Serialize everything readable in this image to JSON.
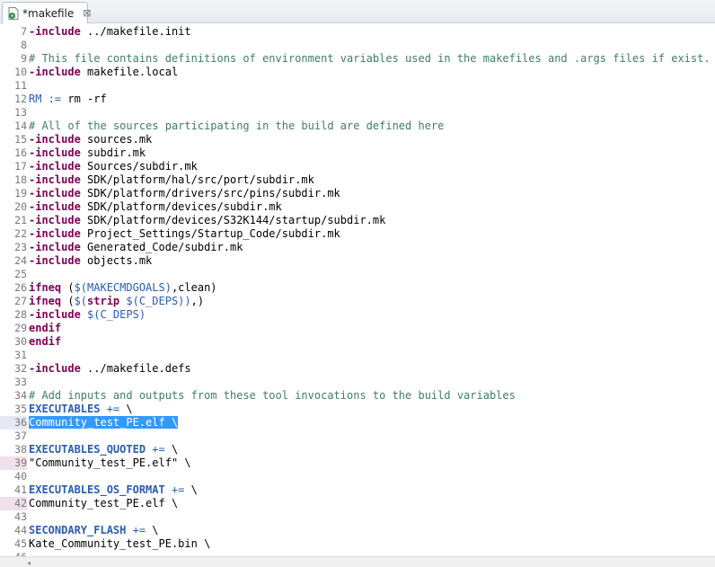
{
  "tab": {
    "title": "*makefile",
    "close_glyph": "⊠"
  },
  "lines": [
    {
      "n": "7",
      "parts": [
        {
          "c": "kw",
          "t": "-include"
        },
        {
          "c": "txt",
          "t": " ../makefile.init"
        }
      ]
    },
    {
      "n": "8",
      "parts": []
    },
    {
      "n": "9",
      "parts": [
        {
          "c": "cmt",
          "t": "# This file contains definitions of environment variables used in the makefiles and .args files if exist."
        }
      ]
    },
    {
      "n": "10",
      "parts": [
        {
          "c": "kw",
          "t": "-include"
        },
        {
          "c": "txt",
          "t": " makefile.local"
        }
      ]
    },
    {
      "n": "11",
      "parts": []
    },
    {
      "n": "12",
      "parts": [
        {
          "c": "var",
          "t": "RM"
        },
        {
          "c": "op",
          "t": " :="
        },
        {
          "c": "txt",
          "t": " rm -rf"
        }
      ]
    },
    {
      "n": "13",
      "parts": []
    },
    {
      "n": "14",
      "parts": [
        {
          "c": "cmt",
          "t": "# All of the sources participating in the build are defined here"
        }
      ]
    },
    {
      "n": "15",
      "parts": [
        {
          "c": "kw",
          "t": "-include"
        },
        {
          "c": "txt",
          "t": " sources.mk"
        }
      ]
    },
    {
      "n": "16",
      "parts": [
        {
          "c": "kw",
          "t": "-include"
        },
        {
          "c": "txt",
          "t": " subdir.mk"
        }
      ]
    },
    {
      "n": "17",
      "parts": [
        {
          "c": "kw",
          "t": "-include"
        },
        {
          "c": "txt",
          "t": " Sources/subdir.mk"
        }
      ]
    },
    {
      "n": "18",
      "parts": [
        {
          "c": "kw",
          "t": "-include"
        },
        {
          "c": "txt",
          "t": " SDK/platform/hal/src/port/subdir.mk"
        }
      ]
    },
    {
      "n": "19",
      "parts": [
        {
          "c": "kw",
          "t": "-include"
        },
        {
          "c": "txt",
          "t": " SDK/platform/drivers/src/pins/subdir.mk"
        }
      ]
    },
    {
      "n": "20",
      "parts": [
        {
          "c": "kw",
          "t": "-include"
        },
        {
          "c": "txt",
          "t": " SDK/platform/devices/subdir.mk"
        }
      ]
    },
    {
      "n": "21",
      "parts": [
        {
          "c": "kw",
          "t": "-include"
        },
        {
          "c": "txt",
          "t": " SDK/platform/devices/S32K144/startup/subdir.mk"
        }
      ]
    },
    {
      "n": "22",
      "parts": [
        {
          "c": "kw",
          "t": "-include"
        },
        {
          "c": "txt",
          "t": " Project_Settings/Startup_Code/subdir.mk"
        }
      ]
    },
    {
      "n": "23",
      "parts": [
        {
          "c": "kw",
          "t": "-include"
        },
        {
          "c": "txt",
          "t": " Generated_Code/subdir.mk"
        }
      ]
    },
    {
      "n": "24",
      "parts": [
        {
          "c": "kw",
          "t": "-include"
        },
        {
          "c": "txt",
          "t": " objects.mk"
        }
      ]
    },
    {
      "n": "25",
      "parts": []
    },
    {
      "n": "26",
      "parts": [
        {
          "c": "kw",
          "t": "ifneq"
        },
        {
          "c": "txt",
          "t": " ("
        },
        {
          "c": "var",
          "t": "$(MAKECMDGOALS)"
        },
        {
          "c": "txt",
          "t": ",clean)"
        }
      ]
    },
    {
      "n": "27",
      "parts": [
        {
          "c": "kw",
          "t": "ifneq"
        },
        {
          "c": "txt",
          "t": " ("
        },
        {
          "c": "var",
          "t": "$("
        },
        {
          "c": "kw",
          "t": "strip"
        },
        {
          "c": "var",
          "t": " $(C_DEPS)"
        },
        {
          "c": "var",
          "t": ")"
        },
        {
          "c": "txt",
          "t": ",)"
        }
      ]
    },
    {
      "n": "28",
      "parts": [
        {
          "c": "kw",
          "t": "-include"
        },
        {
          "c": "txt",
          "t": " "
        },
        {
          "c": "var",
          "t": "$(C_DEPS)"
        }
      ]
    },
    {
      "n": "29",
      "parts": [
        {
          "c": "kw",
          "t": "endif"
        }
      ]
    },
    {
      "n": "30",
      "parts": [
        {
          "c": "kw",
          "t": "endif"
        }
      ]
    },
    {
      "n": "31",
      "parts": []
    },
    {
      "n": "32",
      "parts": [
        {
          "c": "kw",
          "t": "-include"
        },
        {
          "c": "txt",
          "t": " ../makefile.defs"
        }
      ]
    },
    {
      "n": "33",
      "parts": []
    },
    {
      "n": "34",
      "parts": [
        {
          "c": "cmt",
          "t": "# Add inputs and outputs from these tool invocations to the build variables"
        }
      ]
    },
    {
      "n": "35",
      "parts": [
        {
          "c": "var-b",
          "t": "EXECUTABLES"
        },
        {
          "c": "op",
          "t": " +="
        },
        {
          "c": "txt",
          "t": " \\"
        }
      ]
    },
    {
      "n": "36",
      "current": true,
      "parts": [
        {
          "c": "sel-bg",
          "t": "Community_test_PE.elf \\"
        }
      ]
    },
    {
      "n": "37",
      "parts": []
    },
    {
      "n": "38",
      "parts": [
        {
          "c": "var-b",
          "t": "EXECUTABLES_QUOTED"
        },
        {
          "c": "op",
          "t": " +="
        },
        {
          "c": "txt",
          "t": " \\"
        }
      ]
    },
    {
      "n": "39",
      "marker": true,
      "parts": [
        {
          "c": "txt",
          "t": "\"Community_test_PE.elf\" \\"
        }
      ]
    },
    {
      "n": "40",
      "parts": []
    },
    {
      "n": "41",
      "parts": [
        {
          "c": "var-b",
          "t": "EXECUTABLES_OS_FORMAT"
        },
        {
          "c": "op",
          "t": " +="
        },
        {
          "c": "txt",
          "t": " \\"
        }
      ]
    },
    {
      "n": "42",
      "marker": true,
      "parts": [
        {
          "c": "txt",
          "t": "Community_test_PE.elf \\"
        }
      ]
    },
    {
      "n": "43",
      "parts": []
    },
    {
      "n": "44",
      "parts": [
        {
          "c": "var-b",
          "t": "SECONDARY_FLASH"
        },
        {
          "c": "op",
          "t": " +="
        },
        {
          "c": "txt",
          "t": " \\"
        }
      ]
    },
    {
      "n": "45",
      "parts": [
        {
          "c": "txt",
          "t": "Kate_Community_test_PE.bin \\"
        }
      ]
    },
    {
      "n": "46",
      "parts": []
    }
  ],
  "icons": {
    "file": "makefile-file-icon",
    "close": "close-icon"
  },
  "colors": {
    "keyword": "#7f0055",
    "comment": "#3f7f5f",
    "variable": "#2a5db0",
    "selection": "#3399ff"
  }
}
